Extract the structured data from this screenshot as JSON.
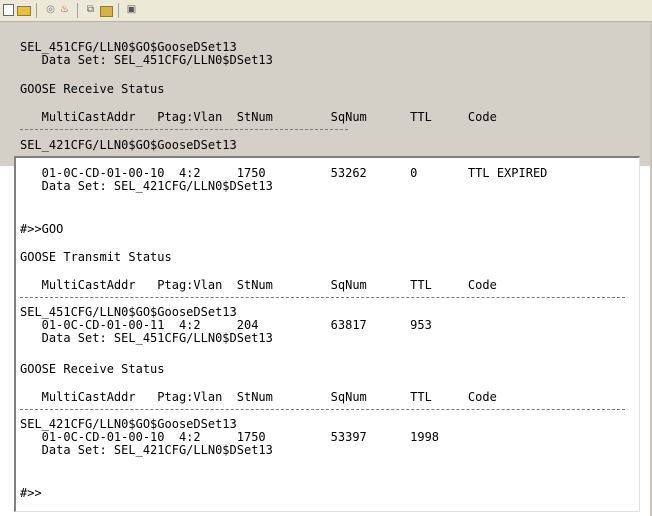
{
  "toolbar": {
    "icons": [
      "new-document-icon",
      "open-folder-icon",
      "disconnect-icon",
      "tools-icon",
      "copy-icon",
      "paste-icon",
      "properties-icon"
    ]
  },
  "console": {
    "block1": {
      "header_line1": "SEL_451CFG/LLN0$GO$GooseDSet13",
      "header_line2": "   Data Set: SEL_451CFG/LLN0$DSet13",
      "section_title": "GOOSE Receive Status",
      "columns": "   MultiCastAddr   Ptag:Vlan  StNum        SqNum      TTL     Code",
      "dashes": "-------------------------------------------",
      "device": "SEL_421CFG/LLN0$GO$GooseDSet13",
      "row": "   01-0C-CD-01-00-10  4:2     1750         53262      0       TTL EXPIRED",
      "row_dataset": "   Data Set: SEL_421CFG/LLN0$DSet13"
    },
    "prompt1": "#>>GOO",
    "transmit": {
      "section_title": "GOOSE Transmit Status",
      "columns": "   MultiCastAddr   Ptag:Vlan  StNum        SqNum      TTL     Code",
      "dashes": "-----------------------------------------------------------------------------",
      "device": "SEL_451CFG/LLN0$GO$GooseDSet13",
      "row": "   01-0C-CD-01-00-11  4:2     204          63817      953",
      "row_dataset": "   Data Set: SEL_451CFG/LLN0$DSet13"
    },
    "receive": {
      "section_title": "GOOSE Receive Status",
      "columns": "   MultiCastAddr   Ptag:Vlan  StNum        SqNum      TTL     Code",
      "dashes": "-----------------------------------------------------------------------------",
      "device": "SEL_421CFG/LLN0$GO$GooseDSet13",
      "row": "   01-0C-CD-01-00-10  4:2     1750         53397      1998",
      "row_dataset": "   Data Set: SEL_421CFG/LLN0$DSet13"
    },
    "prompt2": "#>>"
  }
}
